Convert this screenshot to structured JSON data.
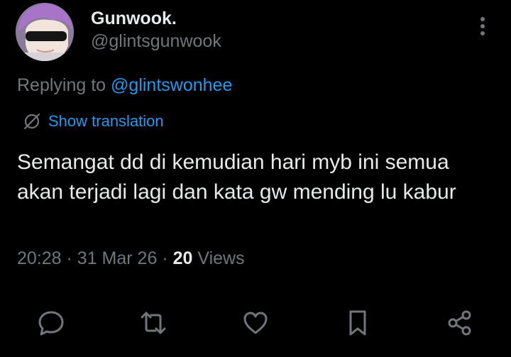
{
  "author": {
    "display_name": "Gunwook.",
    "handle": "@glintsgunwook",
    "avatar_icon": "avatar-photo"
  },
  "reply": {
    "prefix": "Replying to",
    "mention": "@glintswonhee"
  },
  "translation": {
    "label": "Show translation",
    "icon": "globe-slash-icon"
  },
  "tweet": {
    "text": "Semangat dd di kemudian hari myb ini semua akan terjadi lagi dan kata gw mending lu kabur"
  },
  "meta": {
    "time": "20:28",
    "separator1": "·",
    "date": "31 Mar 26",
    "separator2": "·",
    "views_count": "20",
    "views_label": "Views"
  },
  "actions": [
    {
      "name": "reply",
      "icon": "reply-icon"
    },
    {
      "name": "repost",
      "icon": "repost-icon"
    },
    {
      "name": "like",
      "icon": "heart-icon"
    },
    {
      "name": "bookmark",
      "icon": "bookmark-icon"
    },
    {
      "name": "share",
      "icon": "share-icon"
    }
  ],
  "colors": {
    "background": "#000000",
    "primary_text": "#e7e9ea",
    "secondary_text": "#71767b",
    "link": "#1d9bf0"
  }
}
